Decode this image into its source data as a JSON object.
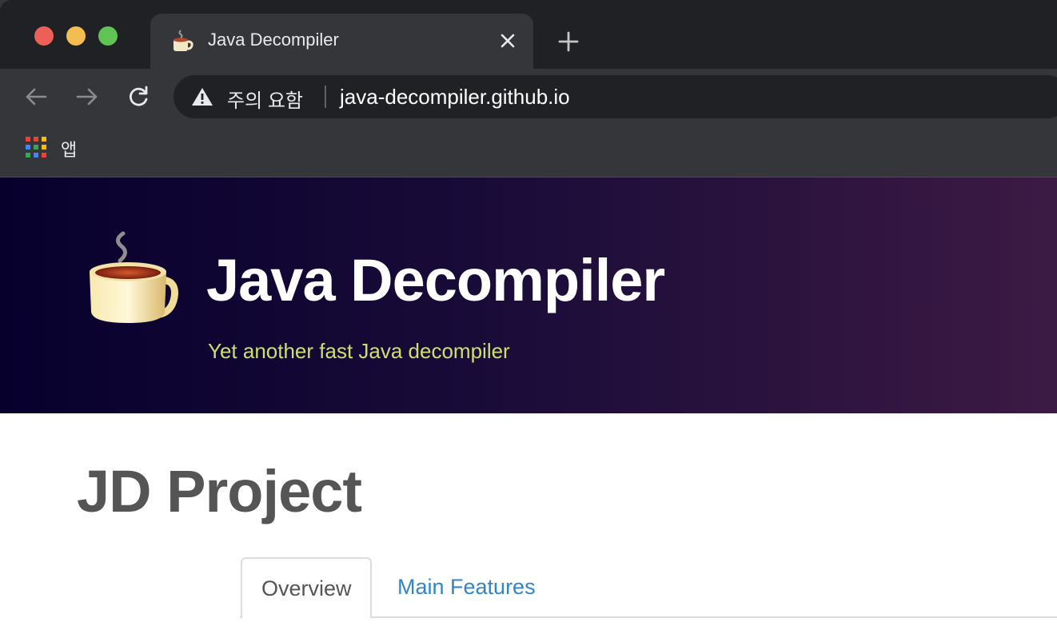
{
  "browser": {
    "tab": {
      "title": "Java Decompiler",
      "favicon": "java-cup-icon"
    },
    "omnibox": {
      "security_label": "주의 요함",
      "url": "java-decompiler.github.io"
    },
    "bookmarks": {
      "apps_label": "앱"
    }
  },
  "hero": {
    "title": "Java Decompiler",
    "tagline": "Yet another fast Java decompiler"
  },
  "main": {
    "heading": "JD Project",
    "tabs": [
      {
        "label": "Overview",
        "active": true
      },
      {
        "label": "Main Features",
        "active": false
      }
    ]
  },
  "colors": {
    "tagline": "#cde06f",
    "link": "#2f86c8",
    "heading": "#555555"
  }
}
